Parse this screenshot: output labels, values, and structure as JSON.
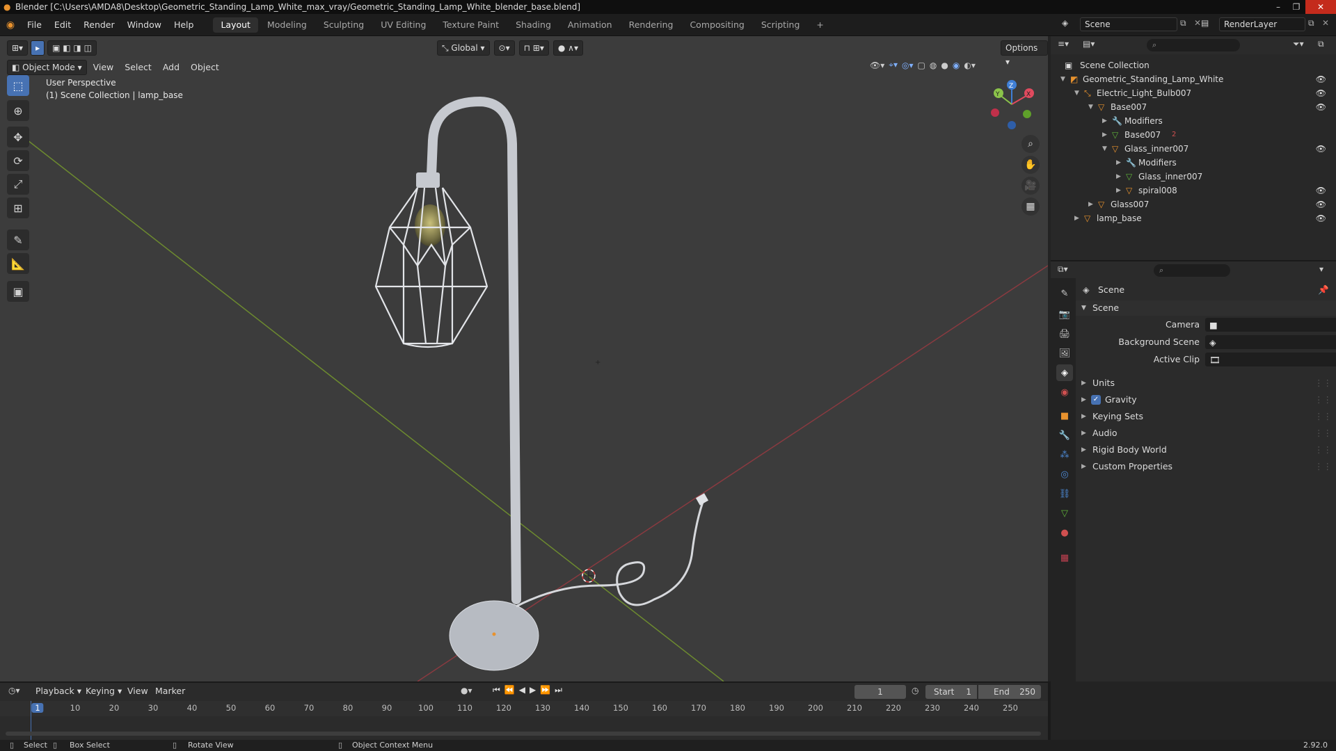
{
  "window": {
    "title": "Blender [C:\\Users\\AMDA8\\Desktop\\Geometric_Standing_Lamp_White_max_vray/Geometric_Standing_Lamp_White_blender_base.blend]"
  },
  "menu": [
    "File",
    "Edit",
    "Render",
    "Window",
    "Help"
  ],
  "workspaces": [
    "Layout",
    "Modeling",
    "Sculpting",
    "UV Editing",
    "Texture Paint",
    "Shading",
    "Animation",
    "Rendering",
    "Compositing",
    "Scripting"
  ],
  "active_workspace": "Layout",
  "scene_name": "Scene",
  "render_layer": "RenderLayer",
  "viewport": {
    "mode": "Object Mode",
    "menus": [
      "View",
      "Select",
      "Add",
      "Object"
    ],
    "transform_orientation": "Global",
    "options_label": "Options",
    "perspective_label": "User Perspective",
    "collection_label": "(1) Scene Collection | lamp_base",
    "gizmo_axes": [
      "X",
      "Y",
      "Z"
    ]
  },
  "outliner": {
    "root": "Scene Collection",
    "items": [
      {
        "label": "Geometric_Standing_Lamp_White",
        "depth": 1,
        "expanded": true,
        "icon": "collection-icon",
        "visible": true
      },
      {
        "label": "Electric_Light_Bulb007",
        "depth": 2,
        "expanded": true,
        "icon": "empty-icon",
        "visible": true
      },
      {
        "label": "Base007",
        "depth": 3,
        "expanded": true,
        "icon": "mesh-object-icon",
        "visible": true
      },
      {
        "label": "Modifiers",
        "depth": 4,
        "expanded": false,
        "icon": "wrench-icon",
        "visible": false
      },
      {
        "label": "Base007",
        "depth": 4,
        "expanded": false,
        "icon": "mesh-data-icon",
        "visible": false,
        "badge": "2"
      },
      {
        "label": "Glass_inner007",
        "depth": 4,
        "expanded": true,
        "icon": "mesh-object-icon",
        "visible": true
      },
      {
        "label": "Modifiers",
        "depth": 5,
        "expanded": false,
        "icon": "wrench-icon",
        "visible": false
      },
      {
        "label": "Glass_inner007",
        "depth": 5,
        "expanded": false,
        "icon": "mesh-data-icon",
        "visible": false
      },
      {
        "label": "spiral008",
        "depth": 5,
        "expanded": false,
        "icon": "mesh-object-icon",
        "visible": true
      },
      {
        "label": "Glass007",
        "depth": 3,
        "expanded": false,
        "icon": "mesh-object-icon",
        "visible": true
      },
      {
        "label": "lamp_base",
        "depth": 2,
        "expanded": false,
        "icon": "mesh-object-icon",
        "visible": true
      }
    ]
  },
  "properties": {
    "context": "Scene",
    "panel_title": "Scene",
    "fields": [
      {
        "label": "Camera",
        "value": ""
      },
      {
        "label": "Background Scene",
        "value": ""
      },
      {
        "label": "Active Clip",
        "value": ""
      }
    ],
    "subpanels": [
      {
        "label": "Units",
        "checkbox": false
      },
      {
        "label": "Gravity",
        "checkbox": true
      },
      {
        "label": "Keying Sets",
        "checkbox": false
      },
      {
        "label": "Audio",
        "checkbox": false
      },
      {
        "label": "Rigid Body World",
        "checkbox": false
      },
      {
        "label": "Custom Properties",
        "checkbox": false
      }
    ]
  },
  "timeline": {
    "menus": [
      "Playback",
      "Keying",
      "View",
      "Marker"
    ],
    "current_frame": "1",
    "start_label": "Start",
    "start": "1",
    "end_label": "End",
    "end": "250",
    "ruler": [
      "1",
      "10",
      "20",
      "30",
      "40",
      "50",
      "60",
      "70",
      "80",
      "90",
      "100",
      "110",
      "120",
      "130",
      "140",
      "150",
      "160",
      "170",
      "180",
      "190",
      "200",
      "210",
      "220",
      "230",
      "240",
      "250"
    ]
  },
  "statusbar": {
    "items": [
      "Select",
      "Box Select",
      "Rotate View",
      "Object Context Menu"
    ],
    "version": "2.92.0"
  },
  "colors": {
    "accent": "#4772b3",
    "x_axis": "#e04a5e",
    "y_axis": "#8bc34a",
    "z_axis": "#3f7fd6",
    "orange_object": "#e8922e"
  }
}
